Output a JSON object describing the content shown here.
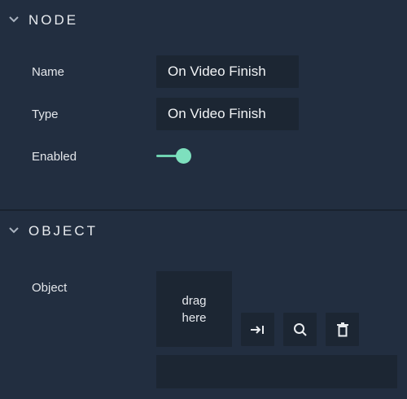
{
  "sections": {
    "node": {
      "title": "NODE",
      "fields": {
        "name": {
          "label": "Name",
          "value": "On Video Finish"
        },
        "type": {
          "label": "Type",
          "value": "On Video Finish"
        },
        "enabled": {
          "label": "Enabled",
          "value": true
        }
      }
    },
    "object": {
      "title": "OBJECT",
      "field_label": "Object",
      "drop_zone": {
        "line1": "drag",
        "line2": "here"
      },
      "buttons": [
        {
          "icon": "assign-icon"
        },
        {
          "icon": "search-icon"
        },
        {
          "icon": "trash-icon"
        }
      ],
      "value": ""
    }
  },
  "colors": {
    "panel_bg": "#222e40",
    "input_bg": "#1c2633",
    "accent": "#7ee0be",
    "text": "#e6e9ee"
  }
}
